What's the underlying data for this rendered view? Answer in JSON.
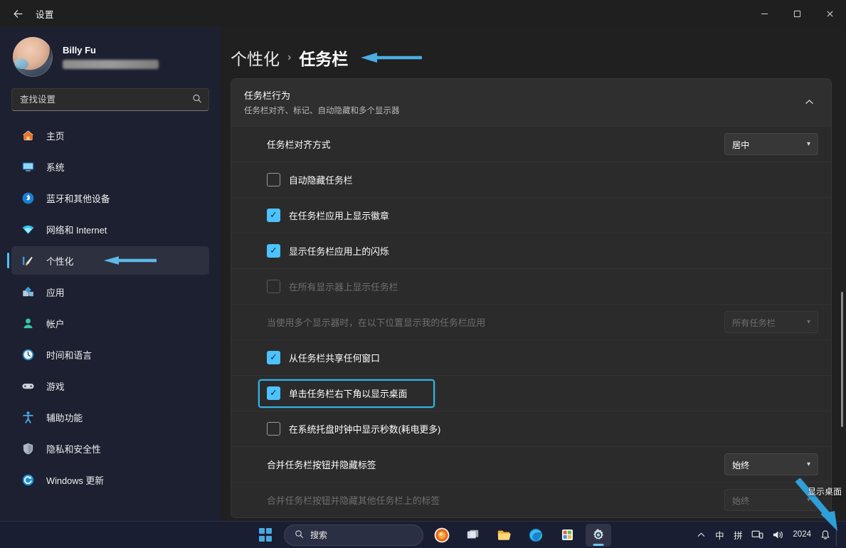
{
  "window": {
    "title": "设置",
    "back_icon": "back-arrow-icon",
    "minimize_label": "–",
    "maximize_label": "❐",
    "close_label": "✕"
  },
  "sidebar": {
    "profile": {
      "name": "Billy Fu",
      "email_masked": ""
    },
    "search": {
      "placeholder": "查找设置",
      "value": "",
      "icon": "search-icon"
    },
    "items": [
      {
        "label": "主页",
        "icon": "home-icon",
        "selected": false
      },
      {
        "label": "系统",
        "icon": "system-icon",
        "selected": false
      },
      {
        "label": "蓝牙和其他设备",
        "icon": "bluetooth-icon",
        "selected": false
      },
      {
        "label": "网络和 Internet",
        "icon": "network-icon",
        "selected": false
      },
      {
        "label": "个性化",
        "icon": "personalization-icon",
        "selected": true
      },
      {
        "label": "应用",
        "icon": "apps-icon",
        "selected": false
      },
      {
        "label": "帐户",
        "icon": "accounts-icon",
        "selected": false
      },
      {
        "label": "时间和语言",
        "icon": "time-language-icon",
        "selected": false
      },
      {
        "label": "游戏",
        "icon": "gaming-icon",
        "selected": false
      },
      {
        "label": "辅助功能",
        "icon": "accessibility-icon",
        "selected": false
      },
      {
        "label": "隐私和安全性",
        "icon": "privacy-security-icon",
        "selected": false
      },
      {
        "label": "Windows 更新",
        "icon": "windows-update-icon",
        "selected": false
      }
    ]
  },
  "breadcrumb": {
    "parent": "个性化",
    "separator": "›",
    "current": "任务栏"
  },
  "card": {
    "title": "任务栏行为",
    "subtitle": "任务栏对齐、标记、自动隐藏和多个显示器",
    "collapse_icon": "chevron-up-icon",
    "rows": [
      {
        "type": "dropdown",
        "label": "任务栏对齐方式",
        "value": "居中",
        "disabled": false
      },
      {
        "type": "checkbox",
        "label": "自动隐藏任务栏",
        "checked": false,
        "disabled": false,
        "highlighted": false
      },
      {
        "type": "checkbox",
        "label": "在任务栏应用上显示徽章",
        "checked": true,
        "disabled": false,
        "highlighted": false
      },
      {
        "type": "checkbox",
        "label": "显示任务栏应用上的闪烁",
        "checked": true,
        "disabled": false,
        "highlighted": false
      },
      {
        "type": "checkbox",
        "label": "在所有显示器上显示任务栏",
        "checked": false,
        "disabled": true,
        "highlighted": false
      },
      {
        "type": "dropdown",
        "label": "当使用多个显示器时，在以下位置显示我的任务栏应用",
        "value": "所有任务栏",
        "disabled": true
      },
      {
        "type": "checkbox",
        "label": "从任务栏共享任何窗口",
        "checked": true,
        "disabled": false,
        "highlighted": false
      },
      {
        "type": "checkbox",
        "label": "单击任务栏右下角以显示桌面",
        "checked": true,
        "disabled": false,
        "highlighted": true
      },
      {
        "type": "checkbox",
        "label": "在系统托盘时钟中显示秒数(耗电更多)",
        "checked": false,
        "disabled": false,
        "highlighted": false
      },
      {
        "type": "dropdown",
        "label": "合并任务栏按钮并隐藏标签",
        "value": "始终",
        "disabled": false
      },
      {
        "type": "dropdown",
        "label": "合并任务栏按钮并隐藏其他任务栏上的标签",
        "value": "始终",
        "disabled": true
      }
    ]
  },
  "taskbar": {
    "start_label": "开始",
    "search_text": "搜索",
    "search_icon": "search-icon",
    "apps": [
      {
        "name": "copilot-icon",
        "glyph": "◉"
      },
      {
        "name": "task-view-icon",
        "glyph": "❐"
      },
      {
        "name": "file-explorer-icon",
        "glyph": "📁"
      },
      {
        "name": "edge-browser-icon",
        "glyph": "◐"
      },
      {
        "name": "microsoft-store-icon",
        "glyph": "📅"
      },
      {
        "name": "settings-icon",
        "glyph": "⚙",
        "active": true
      }
    ],
    "tray": [
      {
        "name": "tray-overflow-chevron",
        "label": "⌃"
      },
      {
        "name": "ime-mode",
        "label": "中"
      },
      {
        "name": "ime-pinyin",
        "label": "拼"
      },
      {
        "name": "display-project-icon",
        "label": "❐"
      },
      {
        "name": "volume-icon",
        "label": "🔊"
      }
    ],
    "clock": {
      "year": "2024"
    },
    "notification_icon": "bell-icon",
    "show_desktop_tooltip": "显示桌面"
  },
  "annotations": {
    "breadcrumb_arrow": "blue-left-arrow",
    "sidebar_arrow": "blue-left-arrow",
    "show_desktop_label": "显示桌面",
    "show_desktop_arrow": "blue-diagonal-arrow",
    "accent_color": "#4cc2ff",
    "annotation_color": "#2fa8e0",
    "highlight_color": "#31b4e8"
  }
}
